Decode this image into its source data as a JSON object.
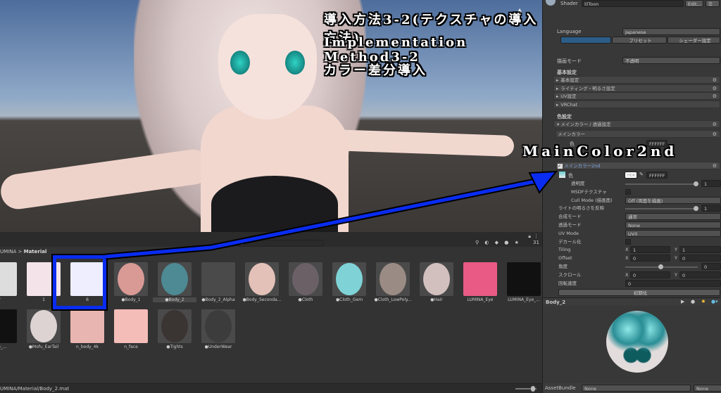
{
  "overlay": {
    "line1": "導入方法3-2(テクスチャの導入方法)",
    "line2": "Implementation Method3-2",
    "line3": "カラー差分導入",
    "callout": "MainColor2nd"
  },
  "colors": {
    "accent": "#0a2cf0",
    "selection": "#2c5d87"
  },
  "project": {
    "breadcrumb": {
      "root": "UMINA",
      "sep": ">",
      "current": "Material"
    },
    "search_placeholder": "",
    "hidden_count": "31",
    "status_path": "UMINA/Material/Body_2.mat",
    "row1": [
      {
        "label": "r",
        "color": "#ddd",
        "mat": false
      },
      {
        "label": "1",
        "color": "#f4e4ea",
        "mat": false
      },
      {
        "label": "6",
        "color": "#eef",
        "mat": false
      },
      {
        "label": "Body_1",
        "color": "#d99a96",
        "mat": true
      },
      {
        "label": "Body_2",
        "color": "#4d8a93",
        "mat": true
      },
      {
        "label": "Body_2_Alpha",
        "color": "#4a4a4a",
        "mat": true
      },
      {
        "label": "Body_Seconda...",
        "color": "#e3c1b8",
        "mat": true
      },
      {
        "label": "Cloth",
        "color": "#6a6066",
        "mat": true
      },
      {
        "label": "Cloth_Gem",
        "color": "#7fd3d6",
        "mat": true
      },
      {
        "label": "Cloth_LowPoly...",
        "color": "#9a8c84",
        "mat": true
      },
      {
        "label": "Hair",
        "color": "#d2c0bf",
        "mat": true
      },
      {
        "label": "LUMINA_Eye",
        "color": "#e95a85",
        "mat": false
      },
      {
        "label": "LUMINA_Eye_...",
        "color": "#111",
        "mat": false
      }
    ],
    "row2": [
      {
        "label": "ace_...",
        "color": "#111",
        "mat": false
      },
      {
        "label": "Mofu_EarTail",
        "color": "#ddd3d3",
        "mat": true
      },
      {
        "label": "n_body_4k",
        "color": "#e9b5b0",
        "mat": false
      },
      {
        "label": "n_face",
        "color": "#f4bdb8",
        "mat": false
      },
      {
        "label": "Tights",
        "color": "#3a3432",
        "mat": true
      },
      {
        "label": "UnderWear",
        "color": "#3c3c3c",
        "mat": true
      }
    ]
  },
  "inspector": {
    "shader_label": "Shader",
    "shader_value": "lilToon",
    "edit_label": "Edit...",
    "language_label": "Language",
    "language_value": "Japanese",
    "preset_label": "プリセット",
    "shader_settings_label": "シェーダー設定",
    "render_mode_label": "描画モード",
    "render_mode_value": "不透明",
    "basic_header": "基本設定",
    "basic_folds": [
      "基本設定",
      "ライティング・明るさ設定",
      "UV設定",
      "VRChat"
    ],
    "color_header": "色設定",
    "color_fold": "メインカラー / 透過設定",
    "main_color_label": "メインカラー",
    "color_label": "色",
    "hex1": "FFFFFF",
    "main2_label": "メインカラー2nd",
    "color2_label": "色",
    "hdr": "HDR",
    "hex2": "FFFFFF",
    "rows": [
      {
        "label": "透明度",
        "type": "slider",
        "value": "1",
        "fill": 1.0,
        "indent": true
      },
      {
        "label": "MSDFテクスチャ",
        "type": "check",
        "indent": true
      },
      {
        "label": "Cull Mode (描画面)",
        "type": "dropdown",
        "value": "Off (両面を描画)",
        "indent": true
      },
      {
        "label": "ライトの明るさを反映",
        "type": "slider",
        "value": "1",
        "fill": 1.0
      },
      {
        "label": "合成モード",
        "type": "dropdown",
        "value": "通常"
      },
      {
        "label": "透過モード",
        "type": "dropdown",
        "value": "None"
      },
      {
        "label": "UV Mode",
        "type": "dropdown",
        "value": "UV0"
      },
      {
        "label": "デカール化",
        "type": "check"
      },
      {
        "label": "Tiling",
        "type": "xy",
        "x": "1",
        "y": "1"
      },
      {
        "label": "Offset",
        "type": "xy",
        "x": "0",
        "y": "0"
      },
      {
        "label": "角度",
        "type": "slider",
        "value": "0",
        "fill": 0.5
      },
      {
        "label": "スクロール",
        "type": "xy",
        "x": "0",
        "y": "0"
      },
      {
        "label": "回転速度",
        "type": "text",
        "value": "0"
      }
    ],
    "reset_label": "初期化",
    "preview_title": "Body_2",
    "assetbundle_label": "AssetBundle",
    "assetbundle_value": "None",
    "variant_value": "None"
  }
}
